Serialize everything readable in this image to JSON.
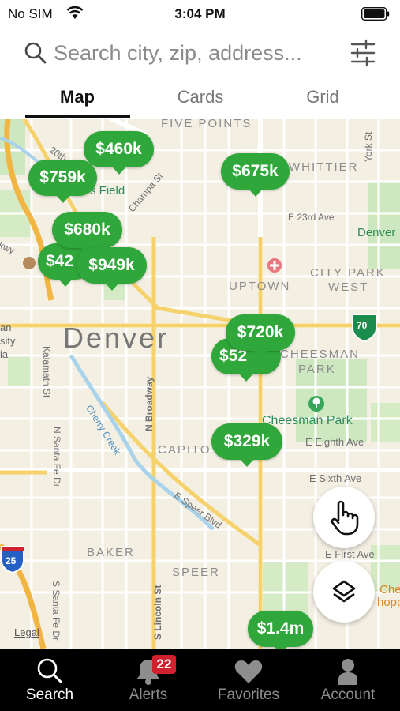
{
  "status_bar": {
    "carrier": "No SIM",
    "time": "3:04 PM"
  },
  "search": {
    "placeholder": "Search city, zip, address..."
  },
  "view_tabs": [
    {
      "label": "Map",
      "active": true
    },
    {
      "label": "Cards",
      "active": false
    },
    {
      "label": "Grid",
      "active": false
    }
  ],
  "map": {
    "city_label": "Denver",
    "neighborhoods": [
      "FIVE POINTS",
      "WHITTIER",
      "UPTOWN",
      "CITY PARK",
      "WEST",
      "CHEESMAN",
      "PARK",
      "CAPITO",
      "BAKER",
      "SPEER"
    ],
    "streets": [
      "20th",
      "Champa St",
      "E 23rd Ave",
      "Kalamath St",
      "N Santa Fe Dr",
      "N Broadway",
      "Cherry Creek",
      "E Eighth Ave",
      "E Sixth Ave",
      "E Speer Blvd",
      "E First Ave",
      "S Lincoln St",
      "S Santa Fe Dr",
      "York St",
      "kwy"
    ],
    "places": [
      "s Field",
      "Denver",
      "Cheesman Park",
      "Che",
      "hopp"
    ],
    "edge_labels": [
      "an",
      "sity",
      "ia"
    ],
    "highway_shields": [
      "70",
      "25"
    ],
    "legal": "Legal"
  },
  "listings": [
    {
      "price": "$460k"
    },
    {
      "price": "$759k"
    },
    {
      "price": "$675k"
    },
    {
      "price": "$680k"
    },
    {
      "price": "$42"
    },
    {
      "price": "$949k"
    },
    {
      "price": "$52"
    },
    {
      "price": "$720k"
    },
    {
      "price": "$329k"
    },
    {
      "price": "$1.4m"
    }
  ],
  "tab_bar": [
    {
      "label": "Search",
      "icon": "search-icon",
      "active": true
    },
    {
      "label": "Alerts",
      "icon": "bell-icon",
      "active": false,
      "badge": "22"
    },
    {
      "label": "Favorites",
      "icon": "heart-icon",
      "active": false
    },
    {
      "label": "Account",
      "icon": "person-icon",
      "active": false
    }
  ],
  "colors": {
    "pin": "#2fa73a",
    "badge": "#d0212e",
    "tab_bar": "#000000"
  }
}
